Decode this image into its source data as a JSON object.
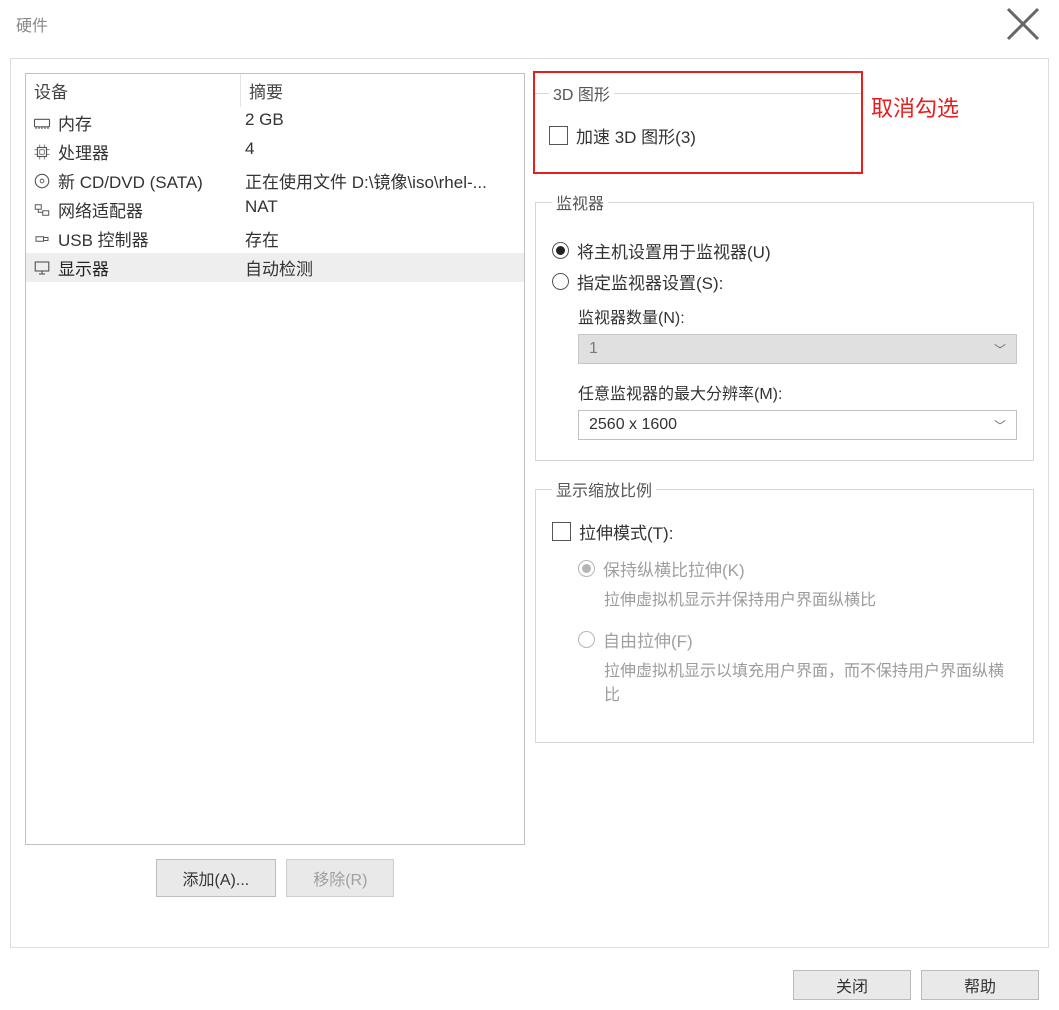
{
  "window": {
    "title": "硬件"
  },
  "table": {
    "headers": {
      "device": "设备",
      "summary": "摘要"
    },
    "rows": [
      {
        "icon": "memory",
        "device": "内存",
        "summary": "2 GB",
        "selected": false
      },
      {
        "icon": "cpu",
        "device": "处理器",
        "summary": "4",
        "selected": false
      },
      {
        "icon": "cd",
        "device": "新 CD/DVD (SATA)",
        "summary": "正在使用文件 D:\\镜像\\iso\\rhel-...",
        "selected": false
      },
      {
        "icon": "net",
        "device": "网络适配器",
        "summary": "NAT",
        "selected": false
      },
      {
        "icon": "usb",
        "device": "USB 控制器",
        "summary": "存在",
        "selected": false
      },
      {
        "icon": "display",
        "device": "显示器",
        "summary": "自动检测",
        "selected": true
      }
    ]
  },
  "buttons": {
    "add": "添加(A)...",
    "remove": "移除(R)",
    "close": "关闭",
    "help": "帮助"
  },
  "annotation": "取消勾选",
  "group_3d": {
    "legend": "3D 图形",
    "accel_label": "加速 3D 图形(3)",
    "accel_checked": false
  },
  "group_monitor": {
    "legend": "监视器",
    "radio_host": "将主机设置用于监视器(U)",
    "radio_specify": "指定监视器设置(S):",
    "radio_selected": "host",
    "count_label": "监视器数量(N):",
    "count_value": "1",
    "maxres_label": "任意监视器的最大分辨率(M):",
    "maxres_value": "2560 x 1600"
  },
  "group_scale": {
    "legend": "显示缩放比例",
    "stretch_label": "拉伸模式(T):",
    "stretch_checked": false,
    "keep_aspect_label": "保持纵横比拉伸(K)",
    "keep_aspect_desc": "拉伸虚拟机显示并保持用户界面纵横比",
    "free_stretch_label": "自由拉伸(F)",
    "free_stretch_desc": "拉伸虚拟机显示以填充用户界面，而不保持用户界面纵横比"
  }
}
